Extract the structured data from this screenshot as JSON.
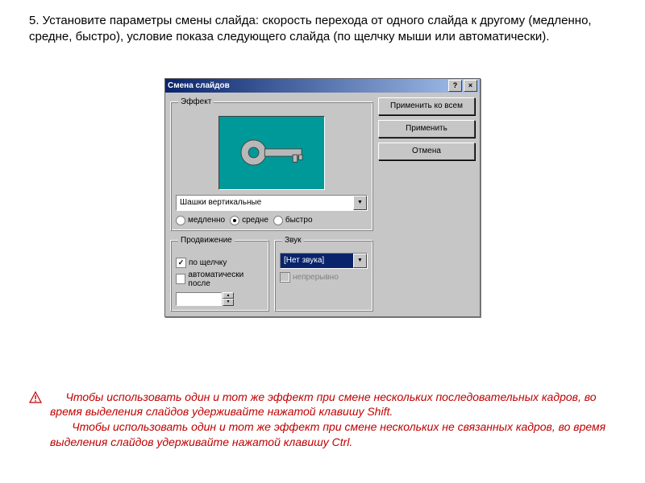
{
  "instruction": "5.  Установите параметры смены слайда: скорость перехода от одного слайда к другому (медленно, средне, быстро), условие показа следующего слайда (по щелчку мыши или автоматически).",
  "dialog": {
    "title": "Смена слайдов",
    "help_btn": "?",
    "close_btn": "×",
    "effect_group": "Эффект",
    "effect_value": "Шашки вертикальные",
    "speed": {
      "slow": "медленно",
      "medium": "средне",
      "fast": "быстро"
    },
    "advance_group": "Продвижение",
    "on_click": "по щелчку",
    "auto_after": "автоматически после",
    "sound_group": "Звук",
    "sound_value": "[Нет звука]",
    "loop": "непрерывно",
    "btn_apply_all": "Применить ко всем",
    "btn_apply": "Применить",
    "btn_cancel": "Отмена"
  },
  "note1": "     Чтобы использовать один и тот же эффект при смене нескольких последовательных кадров, во время выделения слайдов удерживайте нажатой клавишу Shift.",
  "note2": "       Чтобы использовать один и тот же эффект при смене нескольких не связанных кадров, во время выделения слайдов удерживайте нажатой клавишу Ctrl."
}
